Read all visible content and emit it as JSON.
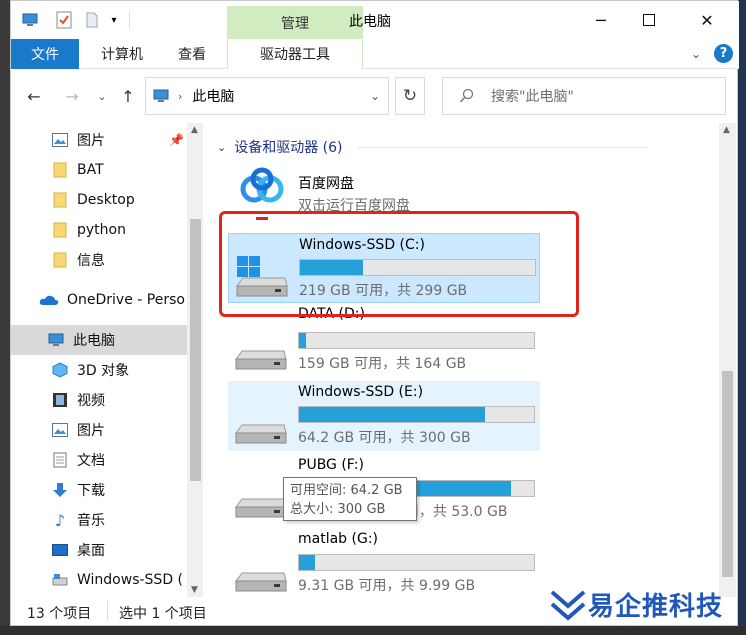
{
  "window": {
    "title": "此电脑",
    "manage_tab": "管理"
  },
  "ribbon": {
    "tabs": [
      "文件",
      "计算机",
      "查看",
      "驱动器工具"
    ],
    "help": "?"
  },
  "address": {
    "path": "此电脑",
    "search_placeholder": "搜索\"此电脑\""
  },
  "nav": {
    "items": [
      {
        "label": "图片",
        "icon": "pictures-icon",
        "pinned": true
      },
      {
        "label": "BAT",
        "icon": "folder-icon"
      },
      {
        "label": "Desktop",
        "icon": "folder-icon"
      },
      {
        "label": "python",
        "icon": "folder-icon"
      },
      {
        "label": "信息",
        "icon": "folder-icon"
      },
      {
        "label": "OneDrive - Perso",
        "icon": "onedrive-icon"
      },
      {
        "label": "此电脑",
        "icon": "this-pc-icon"
      },
      {
        "label": "3D 对象",
        "icon": "3d-objects-icon"
      },
      {
        "label": "视频",
        "icon": "videos-icon"
      },
      {
        "label": "图片",
        "icon": "pictures-icon"
      },
      {
        "label": "文档",
        "icon": "documents-icon"
      },
      {
        "label": "下载",
        "icon": "downloads-icon"
      },
      {
        "label": "音乐",
        "icon": "music-icon"
      },
      {
        "label": "桌面",
        "icon": "desktop-icon"
      },
      {
        "label": "Windows-SSD (",
        "icon": "drive-icon"
      }
    ]
  },
  "content": {
    "group_label": "设备和驱动器 (6)",
    "app": {
      "name": "百度网盘",
      "desc": "双击运行百度网盘"
    },
    "drives": [
      {
        "name": "Windows-SSD (C:)",
        "info": "219 GB 可用，共 299 GB",
        "used_fraction": 0.27,
        "icon": "windows-drive-icon"
      },
      {
        "name": "DATA (D:)",
        "info": "159 GB 可用，共 164 GB",
        "used_fraction": 0.03,
        "icon": "drive-icon"
      },
      {
        "name": "Windows-SSD (E:)",
        "info": "64.2 GB 可用，共 300 GB",
        "used_fraction": 0.79,
        "icon": "drive-icon"
      },
      {
        "name": "PUBG (F:)",
        "info": "GB 可用，共 53.0 GB",
        "used_fraction": 0.9,
        "icon": "drive-icon"
      },
      {
        "name": "matlab (G:)",
        "info": "9.31 GB 可用，共 9.99 GB",
        "used_fraction": 0.07,
        "icon": "drive-icon"
      }
    ],
    "tooltip": {
      "line1": "可用空间: 64.2 GB",
      "line2": "总大小: 300 GB"
    }
  },
  "status": {
    "count": "13 个项目",
    "selected": "选中 1 个项目"
  },
  "watermark": {
    "text": "易企推科技"
  },
  "colors": {
    "accent": "#1979ca",
    "bar": "#26a0da",
    "highlight": "#e0231b"
  }
}
